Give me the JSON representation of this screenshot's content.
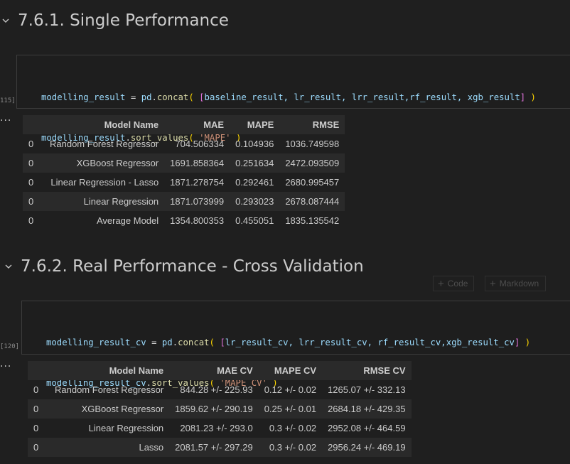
{
  "section1": {
    "title": "7.6.1. Single Performance",
    "exec_count": "115]",
    "code_line1": {
      "var": "modelling_result",
      "eq": " = ",
      "mod": "pd",
      "dot": ".",
      "fn": "concat",
      "open": "( ",
      "br_open": "[",
      "args": "baseline_result, lr_result, lrr_result,rf_result, xgb_result",
      "br_close": "]",
      "close": " )"
    },
    "code_line2": {
      "var": "modelling_result",
      "dot": ".",
      "fn": "sort_values",
      "open": "( ",
      "str": "'MAPE'",
      "close": " )"
    },
    "output_dots": "...",
    "table": {
      "columns": [
        "",
        "Model Name",
        "MAE",
        "MAPE",
        "RMSE"
      ],
      "rows": [
        [
          "0",
          "Random Forest Regressor",
          "704.506334",
          "0.104936",
          "1036.749598"
        ],
        [
          "0",
          "XGBoost Regressor",
          "1691.858364",
          "0.251634",
          "2472.093509"
        ],
        [
          "0",
          "Linear Regression - Lasso",
          "1871.278754",
          "0.292461",
          "2680.995457"
        ],
        [
          "0",
          "Linear Regression",
          "1871.073999",
          "0.293023",
          "2678.087444"
        ],
        [
          "0",
          "Average Model",
          "1354.800353",
          "0.455051",
          "1835.135542"
        ]
      ]
    }
  },
  "section2": {
    "title": "7.6.2. Real Performance - Cross Validation",
    "add_code_label": "Code",
    "add_markdown_label": "Markdown",
    "exec_count": "[120]",
    "code_line1": {
      "var": "modelling_result_cv",
      "eq": " = ",
      "mod": "pd",
      "dot": ".",
      "fn": "concat",
      "open": "( ",
      "br_open": "[",
      "args": "lr_result_cv, lrr_result_cv, rf_result_cv,xgb_result_cv",
      "br_close": "]",
      "close": " )"
    },
    "code_line2": {
      "var": "modelling_result_cv",
      "dot": ".",
      "fn": "sort_values",
      "open": "( ",
      "str": "'MAPE CV'",
      "close": " )"
    },
    "output_dots": "...",
    "table": {
      "columns": [
        "",
        "Model Name",
        "MAE CV",
        "MAPE CV",
        "RMSE CV"
      ],
      "rows": [
        [
          "0",
          "Random Forest Regressor",
          "844.28 +/- 225.93",
          "0.12 +/- 0.02",
          "1265.07 +/- 332.13"
        ],
        [
          "0",
          "XGBoost Regressor",
          "1859.62 +/- 290.19",
          "0.25 +/- 0.01",
          "2684.18 +/- 429.35"
        ],
        [
          "0",
          "Linear Regression",
          "2081.23 +/- 293.0",
          "0.3 +/- 0.02",
          "2952.08 +/- 464.59"
        ],
        [
          "0",
          "Lasso",
          "2081.57 +/- 297.29",
          "0.3 +/- 0.02",
          "2956.24 +/- 469.19"
        ]
      ]
    }
  }
}
